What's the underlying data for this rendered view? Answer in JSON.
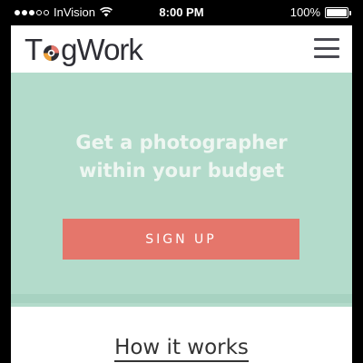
{
  "status_bar": {
    "carrier": "InVision",
    "time": "8:00 PM",
    "battery_percent": "100%",
    "battery_level": 1.0,
    "signal_icon": "signal-dots-icon",
    "wifi_icon": "wifi-icon",
    "battery_icon": "battery-icon"
  },
  "header": {
    "logo_text_start": "T",
    "logo_text_end": "gWork",
    "logo_mark_icon": "camera-lens-icon",
    "menu_icon": "hamburger-menu-icon"
  },
  "hero": {
    "title_line1": "Get a photographer",
    "title_line2": "within your budget",
    "signup_label": "SIGN UP",
    "background_color": "#b3dbcb",
    "button_color": "#e5766b"
  },
  "how_it_works": {
    "heading": "How it works"
  }
}
